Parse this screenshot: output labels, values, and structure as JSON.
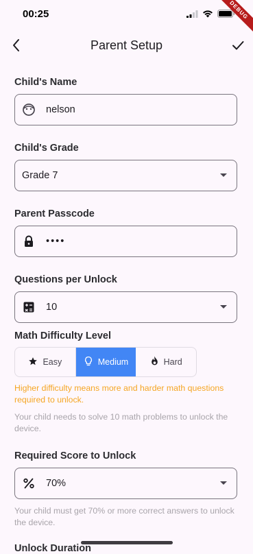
{
  "status": {
    "time": "00:25",
    "debug_label": "DEBUG"
  },
  "app_bar": {
    "title": "Parent Setup",
    "back_icon": "chevron-left-icon",
    "confirm_icon": "check-icon"
  },
  "child_name": {
    "label": "Child's Name",
    "value": "nelson",
    "icon": "face-icon"
  },
  "child_grade": {
    "label": "Child's Grade",
    "value": "Grade 7"
  },
  "passcode": {
    "label": "Parent Passcode",
    "value": "••••",
    "icon": "lock-icon"
  },
  "questions": {
    "label": "Questions per Unlock",
    "value": "10",
    "icon": "calculator-icon"
  },
  "difficulty": {
    "label": "Math Difficulty Level",
    "options": [
      {
        "label": "Easy",
        "icon": "star-icon"
      },
      {
        "label": "Medium",
        "icon": "lightbulb-icon"
      },
      {
        "label": "Hard",
        "icon": "flame-icon"
      }
    ],
    "selected": "Medium",
    "warning": "Higher difficulty means more and harder math questions required to unlock.",
    "hint": "Your child needs to solve 10 math problems to unlock the device."
  },
  "score": {
    "label": "Required Score to Unlock",
    "value": "70%",
    "icon": "percent-icon",
    "hint": "Your child must get 70% or more correct answers to unlock the device."
  },
  "next_section": {
    "label": "Unlock Duration"
  },
  "colors": {
    "background": "#fdf7fd",
    "accent": "#4286f5",
    "warning": "#f5a623",
    "hint": "#a8a4aa"
  }
}
